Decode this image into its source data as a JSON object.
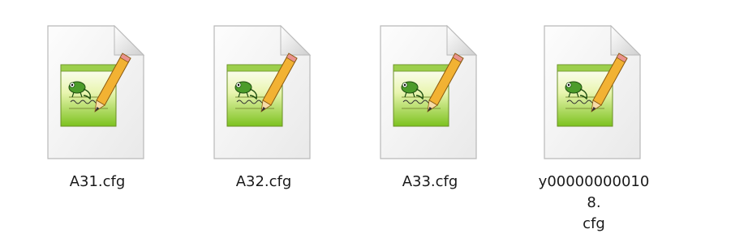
{
  "files": [
    {
      "name": "A31.cfg",
      "icon": "notepad-plus-plus-file-icon"
    },
    {
      "name": "A32.cfg",
      "icon": "notepad-plus-plus-file-icon"
    },
    {
      "name": "A33.cfg",
      "icon": "notepad-plus-plus-file-icon"
    },
    {
      "name": "y000000000108.\ncfg",
      "icon": "notepad-plus-plus-file-icon"
    }
  ]
}
